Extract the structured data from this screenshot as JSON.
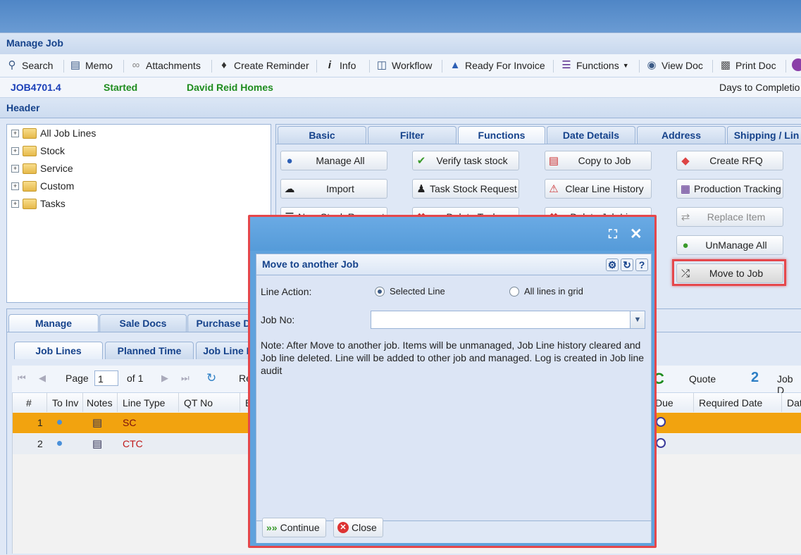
{
  "window": {
    "title": "Manage Job"
  },
  "toolbar": {
    "items": [
      {
        "label": "Search",
        "icon": "search-icon"
      },
      {
        "label": "Memo",
        "icon": "memo-icon"
      },
      {
        "label": "Attachments",
        "icon": "paperclip-icon"
      },
      {
        "label": "Create Reminder",
        "icon": "bell-icon"
      },
      {
        "label": "Info",
        "icon": "info-icon"
      },
      {
        "label": "Workflow",
        "icon": "workflow-icon"
      },
      {
        "label": "Ready For Invoice",
        "icon": "thumbs-up-icon"
      },
      {
        "label": "Functions",
        "icon": "list-icon"
      },
      {
        "label": "View Doc",
        "icon": "eye-icon"
      },
      {
        "label": "Print Doc",
        "icon": "printer-icon"
      }
    ]
  },
  "job": {
    "number": "JOB4701.4",
    "status": "Started",
    "customer": "David Reid Homes",
    "days_label": "Days to Completio"
  },
  "header": {
    "title": "Header"
  },
  "tree": {
    "items": [
      "All Job Lines",
      "Stock",
      "Service",
      "Custom",
      "Tasks"
    ]
  },
  "tabs": {
    "upper": [
      "Basic",
      "Filter",
      "Functions",
      "Date Details",
      "Address",
      "Shipping / Lin"
    ],
    "upper_active": "Functions",
    "lower": [
      "Manage",
      "Sale Docs",
      "Purchase D"
    ],
    "sub": [
      "Job Lines",
      "Planned Time",
      "Job Line H"
    ]
  },
  "functions": {
    "col1": [
      "Manage All",
      "Import",
      "New Stock Request"
    ],
    "col2": [
      "Verify task stock",
      "Task Stock Request",
      "Delete Task"
    ],
    "col3": [
      "Copy to Job",
      "Clear Line History",
      "Delete Job Line"
    ],
    "col4": [
      "Create RFQ",
      "Production Tracking",
      "Replace Item",
      "UnManage All",
      "Move to Job"
    ]
  },
  "pager": {
    "page_label": "Page",
    "page_value": "1",
    "of_label": "of 1",
    "truncated": "Re",
    "quote_letter": "C",
    "quote_label": "Quote",
    "count": "2",
    "job_d": "Job D"
  },
  "grid": {
    "columns": [
      "#",
      "To Inv",
      "Notes",
      "Line Type",
      "QT No",
      "E",
      "Due",
      "Required Date",
      "Dat"
    ],
    "rows": [
      {
        "num": "1",
        "line_type": "SC"
      },
      {
        "num": "2",
        "line_type": "CTC"
      }
    ]
  },
  "dialog": {
    "title": "Move to another Job",
    "line_action_label": "Line Action:",
    "opt_selected": "Selected Line",
    "opt_all": "All lines in grid",
    "job_no_label": "Job No:",
    "note": "Note: After Move to another job. Items will be unmanaged, Job Line history cleared and Job line deleted. Line will be added to other job and managed. Log is created in Job line audit",
    "continue_label": "Continue",
    "close_label": "Close"
  },
  "colors": {
    "accent": "#15428b",
    "job_number": "#1a3fb8",
    "status_green": "#1e8c1e",
    "row_selected": "#f2a30f",
    "highlight": "#e5474b"
  }
}
